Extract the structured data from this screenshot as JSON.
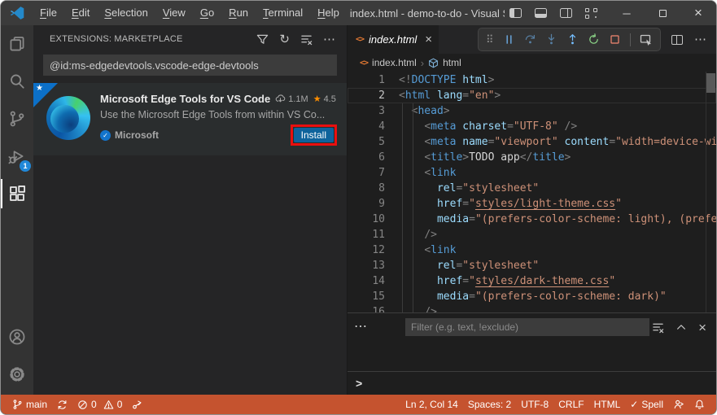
{
  "window": {
    "title": "index.html - demo-to-do - Visual Studio C...",
    "menus": [
      "File",
      "Edit",
      "Selection",
      "View",
      "Go",
      "Run",
      "Terminal",
      "Help"
    ]
  },
  "activity_bar": {
    "debug_badge": "1"
  },
  "sidebar": {
    "header": "EXTENSIONS: MARKETPLACE",
    "search_value": "@id:ms-edgedevtools.vscode-edge-devtools",
    "extension": {
      "name": "Microsoft Edge Tools for VS Code",
      "installs": "1.1M",
      "rating": "4.5",
      "description": "Use the Microsoft Edge Tools from within VS Co...",
      "publisher": "Microsoft",
      "install_label": "Install"
    }
  },
  "editor": {
    "tab": {
      "label": "index.html"
    },
    "breadcrumb": {
      "file": "index.html",
      "symbol": "html"
    },
    "code": {
      "active_line": 2,
      "lines": [
        [
          [
            "p",
            "<!"
          ],
          [
            "tag",
            "DOCTYPE"
          ],
          [
            "txt",
            " "
          ],
          [
            "attr",
            "html"
          ],
          [
            "p",
            ">"
          ]
        ],
        [
          [
            "p",
            "<"
          ],
          [
            "tag",
            "html"
          ],
          [
            "txt",
            " "
          ],
          [
            "attr",
            "lang"
          ],
          [
            "p",
            "="
          ],
          [
            "str",
            "\"en\""
          ],
          [
            "p",
            ">"
          ]
        ],
        [
          [
            "txt",
            "  "
          ],
          [
            "p",
            "<"
          ],
          [
            "tag",
            "head"
          ],
          [
            "p",
            ">"
          ]
        ],
        [
          [
            "txt",
            "    "
          ],
          [
            "p",
            "<"
          ],
          [
            "tag",
            "meta"
          ],
          [
            "txt",
            " "
          ],
          [
            "attr",
            "charset"
          ],
          [
            "p",
            "="
          ],
          [
            "str",
            "\"UTF-8\""
          ],
          [
            "txt",
            " "
          ],
          [
            "p",
            "/>"
          ]
        ],
        [
          [
            "txt",
            "    "
          ],
          [
            "p",
            "<"
          ],
          [
            "tag",
            "meta"
          ],
          [
            "txt",
            " "
          ],
          [
            "attr",
            "name"
          ],
          [
            "p",
            "="
          ],
          [
            "str",
            "\"viewport\""
          ],
          [
            "txt",
            " "
          ],
          [
            "attr",
            "content"
          ],
          [
            "p",
            "="
          ],
          [
            "str",
            "\"width=device-wid"
          ]
        ],
        [
          [
            "txt",
            "    "
          ],
          [
            "p",
            "<"
          ],
          [
            "tag",
            "title"
          ],
          [
            "p",
            ">"
          ],
          [
            "txt",
            "TODO app"
          ],
          [
            "p",
            "</"
          ],
          [
            "tag",
            "title"
          ],
          [
            "p",
            ">"
          ]
        ],
        [
          [
            "txt",
            "    "
          ],
          [
            "p",
            "<"
          ],
          [
            "tag",
            "link"
          ]
        ],
        [
          [
            "txt",
            "      "
          ],
          [
            "attr",
            "rel"
          ],
          [
            "p",
            "="
          ],
          [
            "str",
            "\"stylesheet\""
          ]
        ],
        [
          [
            "txt",
            "      "
          ],
          [
            "attr",
            "href"
          ],
          [
            "p",
            "="
          ],
          [
            "str",
            "\""
          ],
          [
            "stru",
            "styles/light-theme.css"
          ],
          [
            "str",
            "\""
          ]
        ],
        [
          [
            "txt",
            "      "
          ],
          [
            "attr",
            "media"
          ],
          [
            "p",
            "="
          ],
          [
            "str",
            "\"(prefers-color-scheme: light), (prefer"
          ]
        ],
        [
          [
            "txt",
            "    "
          ],
          [
            "p",
            "/>"
          ]
        ],
        [
          [
            "txt",
            "    "
          ],
          [
            "p",
            "<"
          ],
          [
            "tag",
            "link"
          ]
        ],
        [
          [
            "txt",
            "      "
          ],
          [
            "attr",
            "rel"
          ],
          [
            "p",
            "="
          ],
          [
            "str",
            "\"stylesheet\""
          ]
        ],
        [
          [
            "txt",
            "      "
          ],
          [
            "attr",
            "href"
          ],
          [
            "p",
            "="
          ],
          [
            "str",
            "\""
          ],
          [
            "stru",
            "styles/dark-theme.css"
          ],
          [
            "str",
            "\""
          ]
        ],
        [
          [
            "txt",
            "      "
          ],
          [
            "attr",
            "media"
          ],
          [
            "p",
            "="
          ],
          [
            "str",
            "\"(prefers-color-scheme: dark)\""
          ]
        ],
        [
          [
            "txt",
            "    "
          ],
          [
            "p",
            "/>"
          ]
        ]
      ]
    }
  },
  "panel": {
    "filter_placeholder": "Filter (e.g. text, !exclude)"
  },
  "status_bar": {
    "branch": "main",
    "errors": "0",
    "warnings": "0",
    "line_col": "Ln 2, Col 14",
    "spaces": "Spaces: 2",
    "encoding": "UTF-8",
    "eol": "CRLF",
    "language": "HTML",
    "spell": "Spell"
  },
  "icons": {
    "more": "⋯",
    "refresh": "↻",
    "close": "×",
    "minimize": "─",
    "grip": "⠿",
    "chevron": "›",
    "prompt": ">",
    "check": "✓",
    "star": "★",
    "ribbon_star": "★",
    "file_html": "<>"
  },
  "colors": {
    "statusbar_debugging": "#c5532f",
    "install_button": "#0e639c",
    "annotation_red": "#e90f0f",
    "badge_blue": "#2188d8",
    "string_orange": "#ce9178",
    "tag_blue": "#569cd6",
    "attr_blue": "#9cdcfe"
  }
}
